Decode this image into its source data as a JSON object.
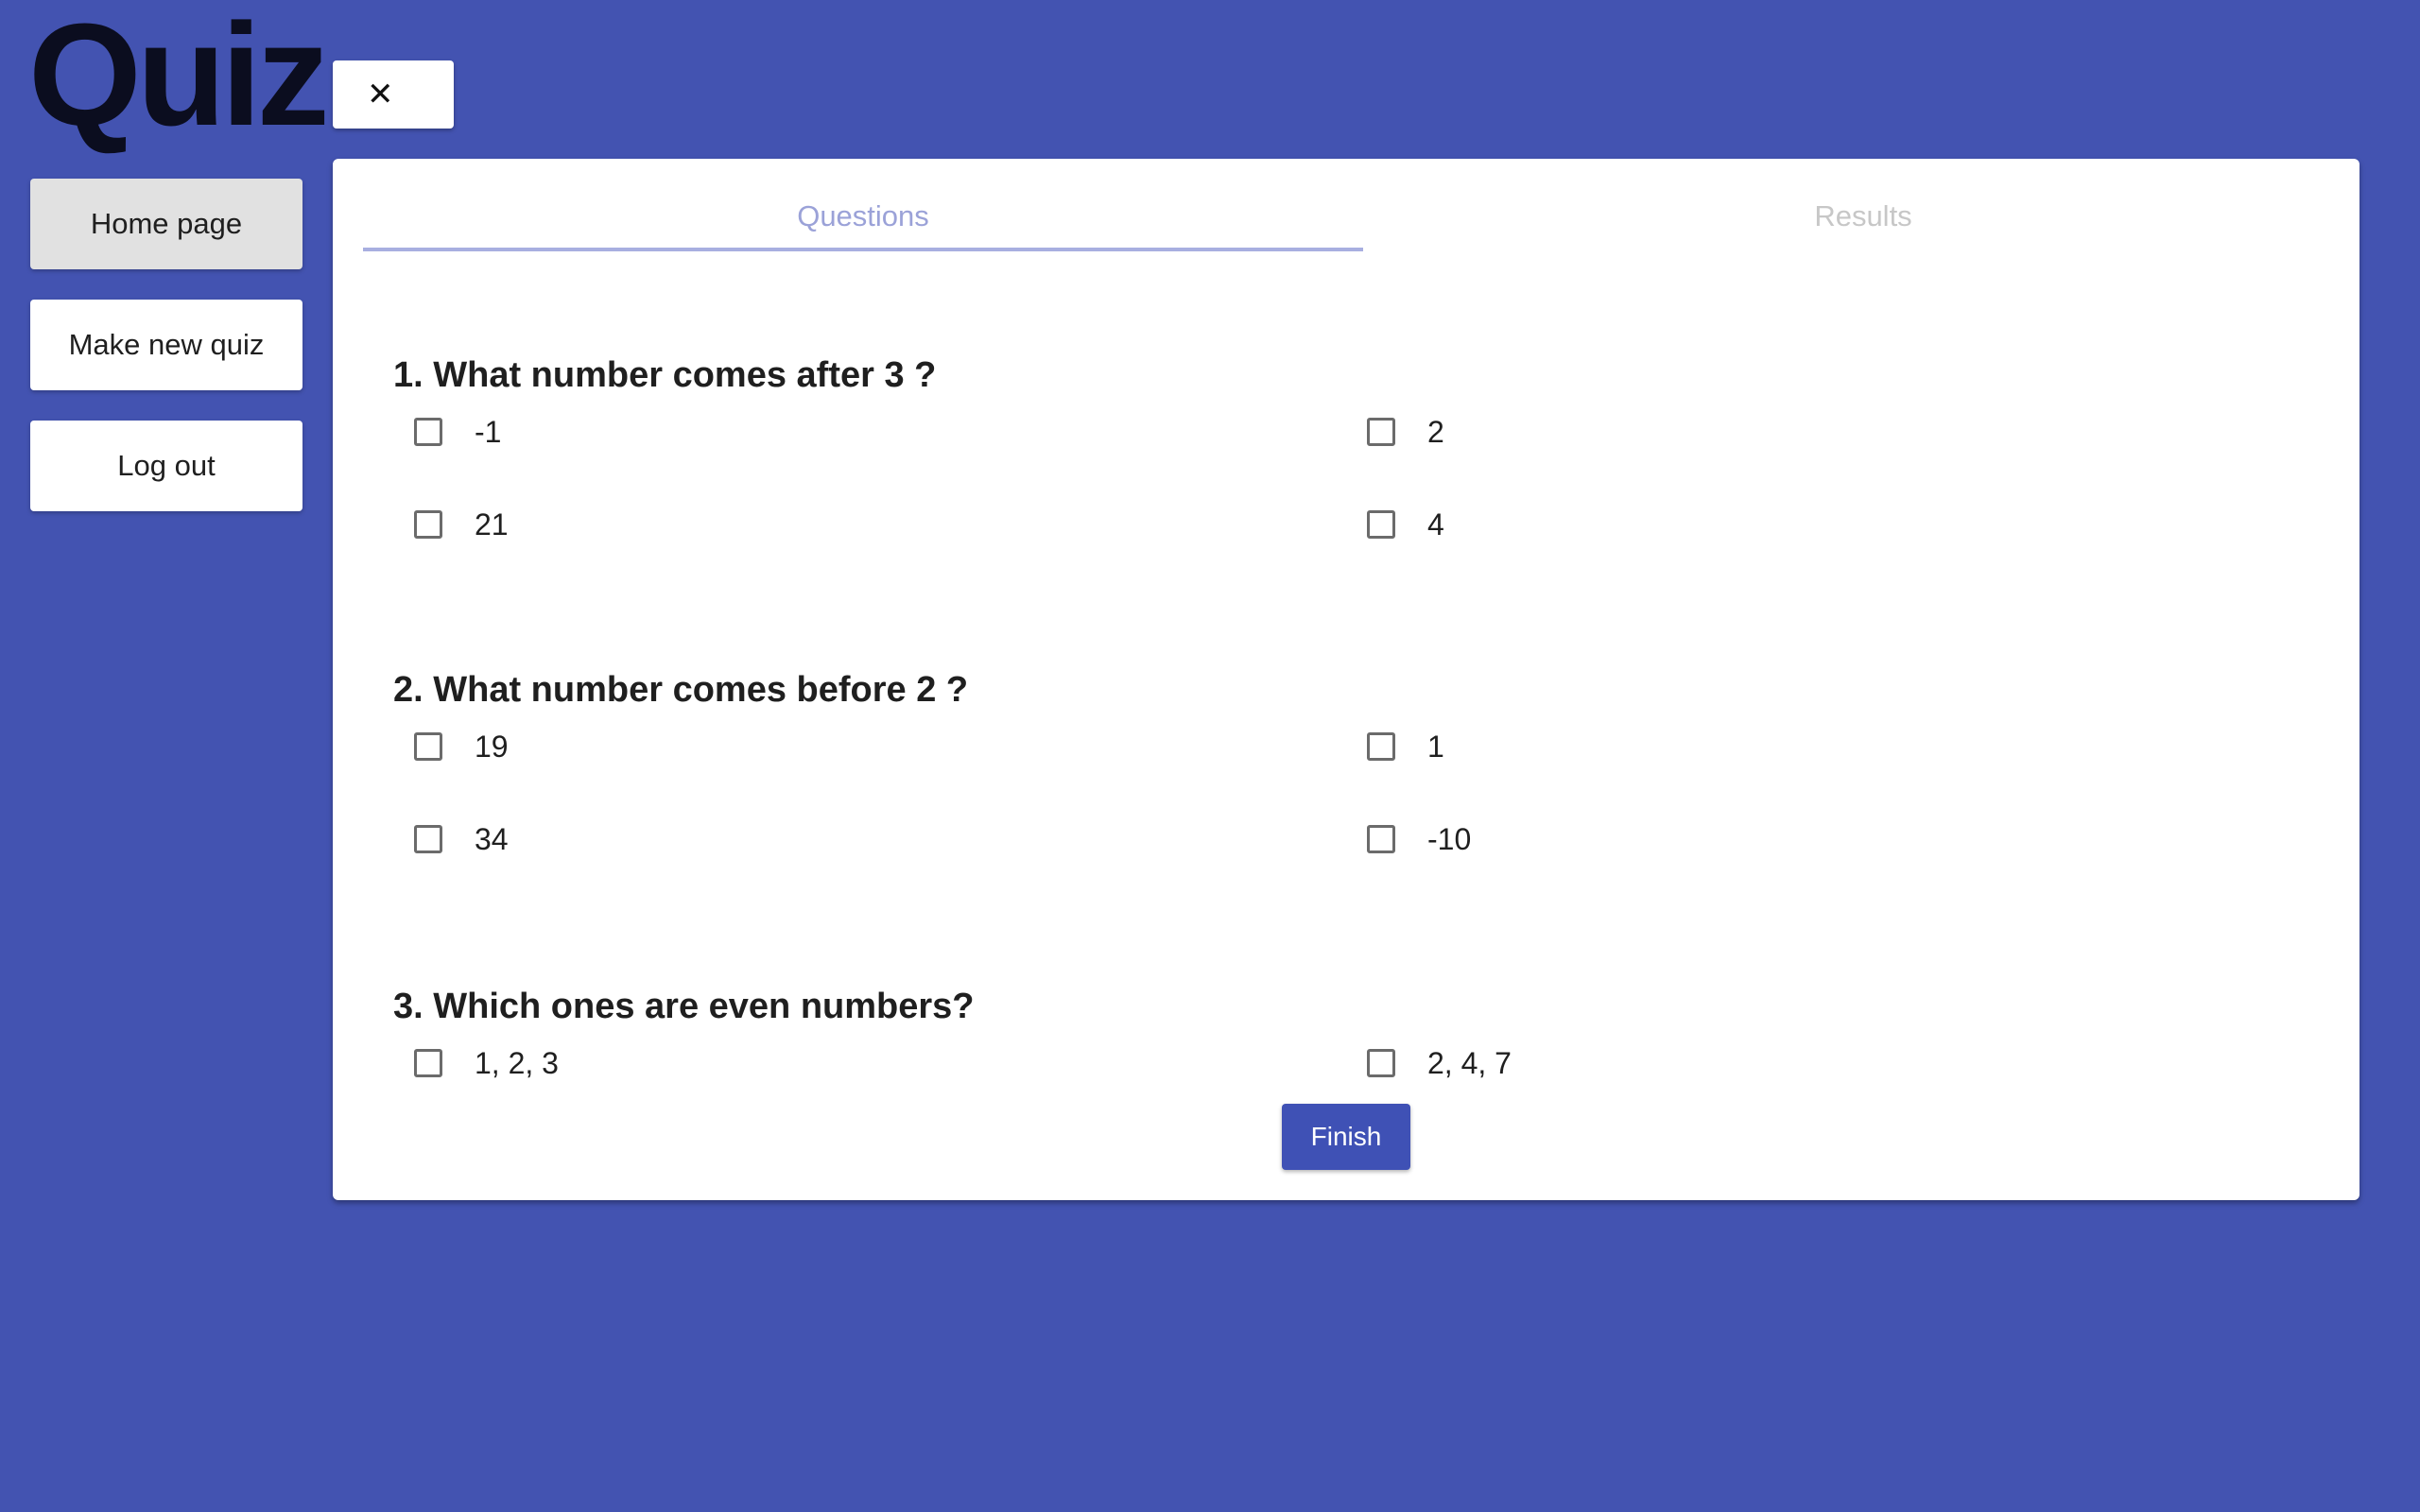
{
  "app": {
    "title": "Quiz",
    "close_label": "✕"
  },
  "nav": {
    "home": "Home page",
    "new_quiz": "Make new quiz",
    "logout": "Log out"
  },
  "tabs": {
    "questions": "Questions",
    "results": "Results"
  },
  "questions": [
    {
      "text": "1. What number comes after 3 ?",
      "options": [
        "-1",
        "2",
        "21",
        "4"
      ]
    },
    {
      "text": "2. What number comes before 2 ?",
      "options": [
        "19",
        "1",
        "34",
        "-10"
      ]
    },
    {
      "text": "3. Which ones are even numbers?",
      "options": [
        "1, 2, 3",
        "2, 4, 7"
      ]
    }
  ],
  "actions": {
    "finish": "Finish"
  },
  "colors": {
    "background": "#4353b1",
    "accent": "#3f51b5",
    "tab_active": "#9ba2d8",
    "tab_inactive": "#c7c7c7"
  }
}
